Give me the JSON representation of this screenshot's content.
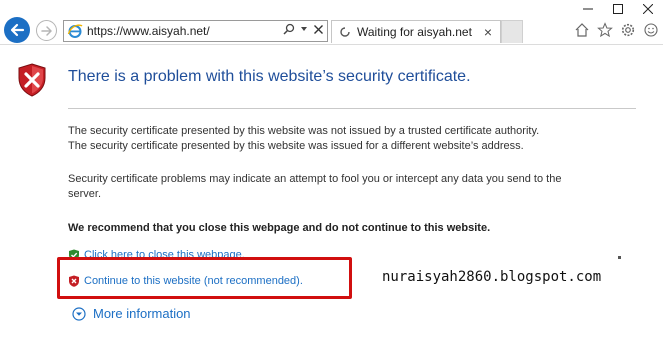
{
  "browser": {
    "address_url": "https://www.aisyah.net/",
    "tab_title": "Waiting for aisyah.net",
    "tab_close": "×",
    "address_tools": "⌕ ▾ ✕"
  },
  "page": {
    "headline": "There is a problem with this website’s security certificate.",
    "paragraph1_line1": "The security certificate presented by this website was not issued by a trusted certificate authority.",
    "paragraph1_line2": "The security certificate presented by this website was issued for a different website’s address.",
    "paragraph2_line1": "Security certificate problems may indicate an attempt to fool you or intercept any data you send to the",
    "paragraph2_line2": "server.",
    "recommendation": "We recommend that you close this webpage and do not continue to this website.",
    "close_link": "Click here to close this webpage.",
    "continue_link": "Continue to this website (not recommended).",
    "more_info": "More information"
  },
  "overlay": {
    "watermark": "nuraisyah2860.blogspot.com",
    "highlight_color": "#d10f0f"
  },
  "colors": {
    "accent": "#1c6fc4",
    "headline": "#1f4e9a",
    "error_red": "#c41e24",
    "ok_green": "#2e8b2e"
  }
}
